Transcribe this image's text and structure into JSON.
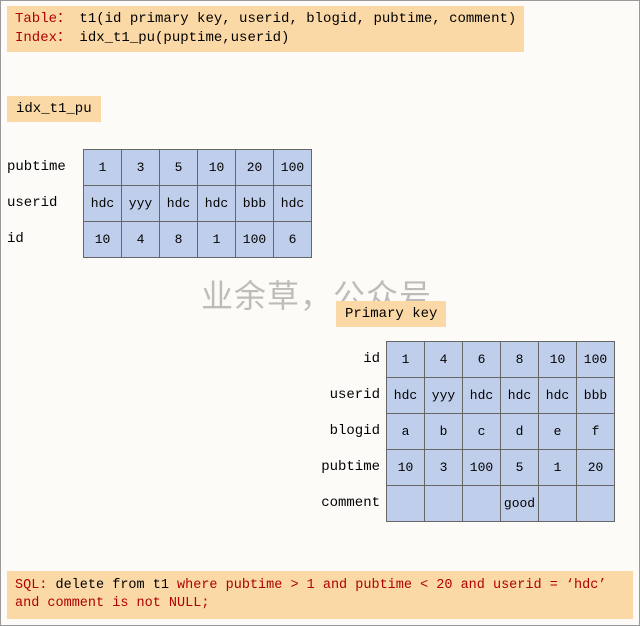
{
  "definitions": {
    "table_kw": "Table：",
    "table_def": " t1(id primary key, userid, blogid, pubtime, comment)",
    "index_kw": "Index：",
    "index_def": " idx_t1_pu(puptime,userid)"
  },
  "secondary_index": {
    "label": "idx_t1_pu",
    "row_labels": [
      "pubtime",
      "userid",
      "id"
    ],
    "rows": [
      [
        "1",
        "3",
        "5",
        "10",
        "20",
        "100"
      ],
      [
        "hdc",
        "yyy",
        "hdc",
        "hdc",
        "bbb",
        "hdc"
      ],
      [
        "10",
        "4",
        "8",
        "1",
        "100",
        "6"
      ]
    ]
  },
  "primary_key": {
    "label": "Primary key",
    "row_labels": [
      "id",
      "userid",
      "blogid",
      "pubtime",
      "comment"
    ],
    "rows": [
      [
        "1",
        "4",
        "6",
        "8",
        "10",
        "100"
      ],
      [
        "hdc",
        "yyy",
        "hdc",
        "hdc",
        "hdc",
        "bbb"
      ],
      [
        "a",
        "b",
        "c",
        "d",
        "e",
        "f"
      ],
      [
        "10",
        "3",
        "100",
        "5",
        "1",
        "20"
      ],
      [
        "",
        "",
        "",
        "good",
        "",
        ""
      ]
    ]
  },
  "sql": {
    "p1": "SQL:",
    "p2": " delete from t1 ",
    "p3": "where pubtime > 1 and pubtime < 20 and userid = ‘hdc’ and comment is not NULL;"
  },
  "watermark": "业余草，公众号",
  "chart_data": [
    {
      "type": "table",
      "title": "idx_t1_pu",
      "row_headers": [
        "pubtime",
        "userid",
        "id"
      ],
      "rows": [
        [
          1,
          3,
          5,
          10,
          20,
          100
        ],
        [
          "hdc",
          "yyy",
          "hdc",
          "hdc",
          "bbb",
          "hdc"
        ],
        [
          10,
          4,
          8,
          1,
          100,
          6
        ]
      ]
    },
    {
      "type": "table",
      "title": "Primary key",
      "row_headers": [
        "id",
        "userid",
        "blogid",
        "pubtime",
        "comment"
      ],
      "rows": [
        [
          1,
          4,
          6,
          8,
          10,
          100
        ],
        [
          "hdc",
          "yyy",
          "hdc",
          "hdc",
          "hdc",
          "bbb"
        ],
        [
          "a",
          "b",
          "c",
          "d",
          "e",
          "f"
        ],
        [
          10,
          3,
          100,
          5,
          1,
          20
        ],
        [
          "",
          "",
          "",
          "good",
          "",
          ""
        ]
      ]
    }
  ]
}
